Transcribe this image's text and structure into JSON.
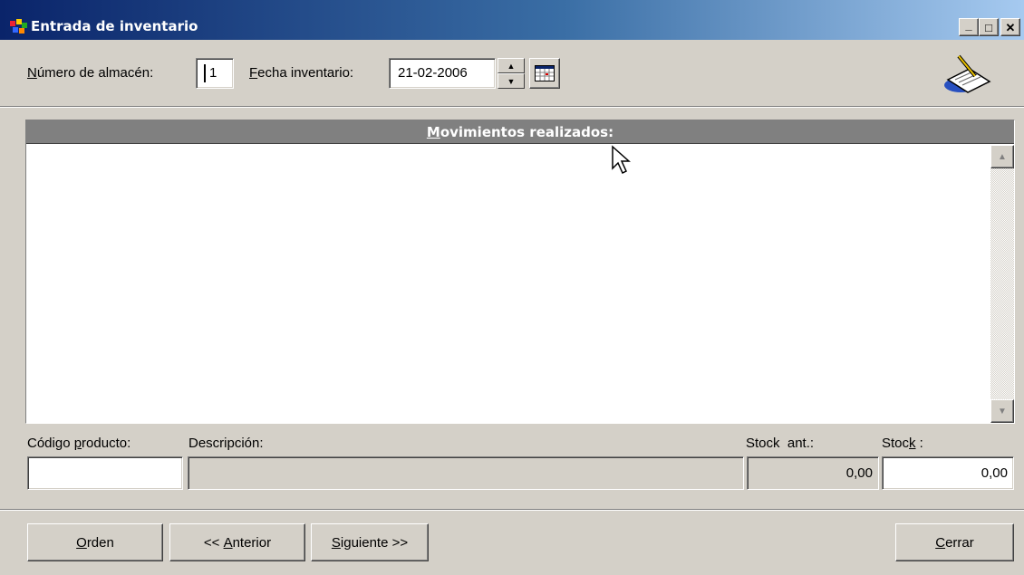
{
  "window": {
    "title": "Entrada de inventario",
    "controls": {
      "minimize": "_",
      "maximize": "□",
      "close": "✕"
    }
  },
  "header": {
    "warehouse_label_accel": "N",
    "warehouse_label_rest": "úmero de almacén:",
    "warehouse_value": "1",
    "date_label_accel": "F",
    "date_label_rest": "echa inventario:",
    "date_value": "21-02-2006"
  },
  "movements": {
    "header_accel": "M",
    "header_rest": "ovimientos realizados:",
    "rows": []
  },
  "fields": {
    "product_code_label_a": "Código ",
    "product_code_label_accel": "p",
    "product_code_label_b": "roducto:",
    "product_code_value": "",
    "description_label": "Descripción:",
    "description_value": "",
    "stock_prev_label": "Stock  ant.:",
    "stock_prev_value": "0,00",
    "stock_label_a": "Stoc",
    "stock_label_accel": "k",
    "stock_label_b": " :",
    "stock_value": "0,00"
  },
  "buttons": {
    "order_accel": "O",
    "order_rest": "rden",
    "prev_a": "<< ",
    "prev_accel": "A",
    "prev_b": "nterior",
    "next_accel": "S",
    "next_rest": "iguiente >>",
    "close_accel": "C",
    "close_rest": "errar"
  },
  "colors": {
    "titlebar_start": "#0a246a",
    "titlebar_end": "#a6caf0",
    "face": "#d4d0c8",
    "list_header": "#808080"
  },
  "icons": [
    "app-icon",
    "notepad-pen-icon",
    "calendar-icon",
    "spin-up-icon",
    "spin-down-icon",
    "scroll-up-icon",
    "scroll-down-icon",
    "mouse-cursor-icon"
  ]
}
